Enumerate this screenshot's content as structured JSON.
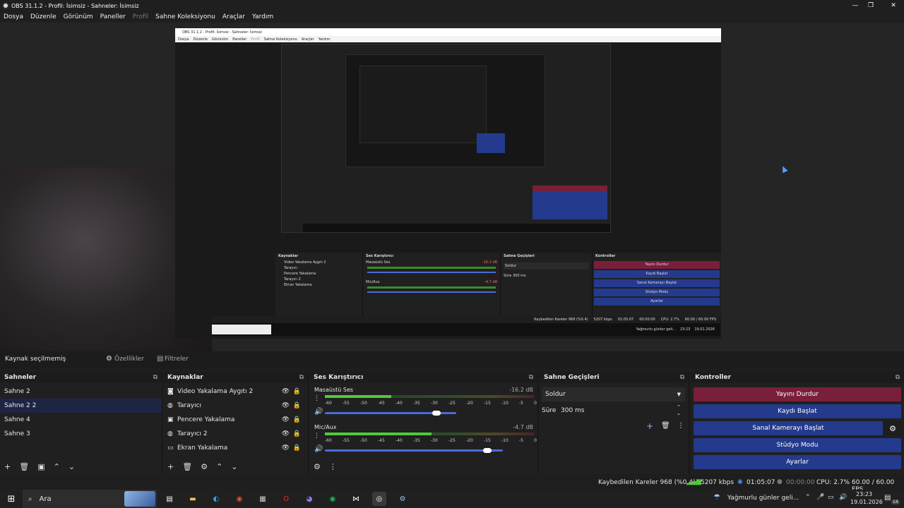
{
  "window": {
    "title": "OBS 31.1.2 - Profil: İsimsiz - Sahneler: İsimsiz"
  },
  "menu": [
    "Dosya",
    "Düzenle",
    "Görünüm",
    "Paneller",
    "Profil",
    "Sahne Koleksiyonu",
    "Araçlar",
    "Yardım"
  ],
  "nested": {
    "title": "OBS 31.1.2 - Profil: İsimsiz - Sahneler: İsimsiz",
    "menu": [
      "Dosya",
      "Düzenle",
      "Görünüm",
      "Paneller",
      "Profil",
      "Sahne Koleksiyonu",
      "Araçlar",
      "Yardım"
    ],
    "tabs": [
      "Özellikler",
      "Filtreler"
    ],
    "sources_title": "Kaynaklar",
    "sources": [
      "Video Yakalama Aygıtı 2",
      "Tarayıcı",
      "Pencere Yakalama",
      "Tarayıcı 2",
      "Ekran Yakalama"
    ],
    "mixer_title": "Ses Karıştırıcı",
    "ch1": "Masaüstü Ses",
    "ch1_db": "-16.2 dB",
    "ch2": "Mic/Aux",
    "ch2_db": "-4.7 dB",
    "trans_title": "Sahne Geçişleri",
    "trans_value": "Soldur",
    "dur_label": "Süre",
    "dur_value": "300 ms",
    "ctl_title": "Kontroller",
    "ctl": [
      "Yayını Durdur",
      "Kaydı Başlat",
      "Sanal Kamerayı Başlat",
      "Stüdyo Modu",
      "Ayarlar"
    ],
    "status": "Kaybedilen Kareler 968 (%0.4)",
    "kbps": "5207 kbps",
    "time": "01:05:07",
    "rec": "00:00:00",
    "cpu": "CPU: 2.7%",
    "fps": "60.00 / 60.00 FPS",
    "weather": "Yağmurlu günler geli...",
    "clock": "23:23",
    "date": "19.01.2026"
  },
  "toolbar": {
    "no_source": "Kaynak seçilmemiş",
    "properties": "Özellikler",
    "filters": "Filtreler"
  },
  "scenes": {
    "title": "Sahneler",
    "items": [
      "Sahne 2",
      "Sahne 2 2",
      "Sahne 4",
      "Sahne 3"
    ],
    "selected_index": 1
  },
  "sources": {
    "title": "Kaynaklar",
    "items": [
      "Video Yakalama Aygıtı 2",
      "Tarayıcı",
      "Pencere Yakalama",
      "Tarayıcı 2",
      "Ekran Yakalama"
    ]
  },
  "mixer": {
    "title": "Ses Karıştırıcı",
    "scale": [
      "-60",
      "-55",
      "-50",
      "-45",
      "-40",
      "-35",
      "-30",
      "-25",
      "-20",
      "-15",
      "-10",
      "-5",
      "0"
    ],
    "channels": [
      {
        "name": "Masaüstü Ses",
        "db": "-16.2 dB",
        "level": 0.58
      },
      {
        "name": "Mic/Aux",
        "db": "-4.7 dB",
        "level": 0.93
      }
    ]
  },
  "transitions": {
    "title": "Sahne Geçişleri",
    "value": "Soldur",
    "duration_label": "Süre",
    "duration_value": "300 ms"
  },
  "controls": {
    "title": "Kontroller",
    "buttons": [
      "Yayını Durdur",
      "Kaydı Başlat",
      "Sanal Kamerayı Başlat",
      "Stüdyo Modu",
      "Ayarlar"
    ]
  },
  "status": {
    "dropped": "Kaybedilen Kareler 968 (%0.4)",
    "kbps": "5207 kbps",
    "stream_time": "01:05:07",
    "rec_time": "00:00:00",
    "cpu": "CPU: 2.7%",
    "fps": "60.00 / 60.00 FPS"
  },
  "taskbar": {
    "search": "Ara",
    "weather": "Yağmurlu günler geli...",
    "time": "23:23",
    "date": "19.01.2026",
    "badge": "14"
  },
  "colors": {
    "stop_stream": "#7a1f3a",
    "button": "#243a8c",
    "selected": "#1e2544"
  },
  "icons": [
    "windows-start-icon",
    "search-icon",
    "task-view-icon",
    "file-explorer-icon",
    "edge-icon",
    "chrome-icon",
    "calculator-icon",
    "opera-icon",
    "discord-icon",
    "spotify-icon",
    "capcut-icon",
    "obs-icon",
    "steam-icon"
  ]
}
